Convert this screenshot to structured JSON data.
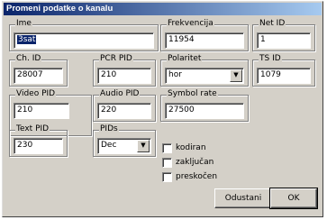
{
  "window": {
    "title": "Promeni podatke o kanalu"
  },
  "groups": {
    "ime": {
      "label": "Ime",
      "value": "3sat"
    },
    "frekvencija": {
      "label": "Frekvencija",
      "value": "11954"
    },
    "net_id": {
      "label": "Net ID",
      "value": "1"
    },
    "ch_id": {
      "label": "Ch. ID",
      "value": "28007"
    },
    "pcr_pid": {
      "label": "PCR PID",
      "value": "210"
    },
    "polaritet": {
      "label": "Polaritet",
      "value": "hor"
    },
    "ts_id": {
      "label": "TS ID",
      "value": "1079"
    },
    "video_pid": {
      "label": "Video PID",
      "value": "210"
    },
    "audio_pid": {
      "label": "Audio PID",
      "value": "220"
    },
    "symbol_rate": {
      "label": "Symbol rate",
      "value": "27500"
    },
    "text_pid": {
      "label": "Text PID",
      "value": "230"
    },
    "pids": {
      "label": "PIDs",
      "value": "Dec"
    }
  },
  "checkboxes": [
    {
      "label": "kodiran",
      "checked": false
    },
    {
      "label": "zaključan",
      "checked": false
    },
    {
      "label": "preskočen",
      "checked": false
    }
  ],
  "buttons": {
    "cancel": "Odustani",
    "ok": "OK"
  },
  "icons": {
    "combo_arrow": "chevron-down-icon"
  },
  "colors": {
    "titlebar_start": "#0a246a",
    "titlebar_end": "#a6caf0",
    "dialog_bg": "#d4d0c8"
  }
}
